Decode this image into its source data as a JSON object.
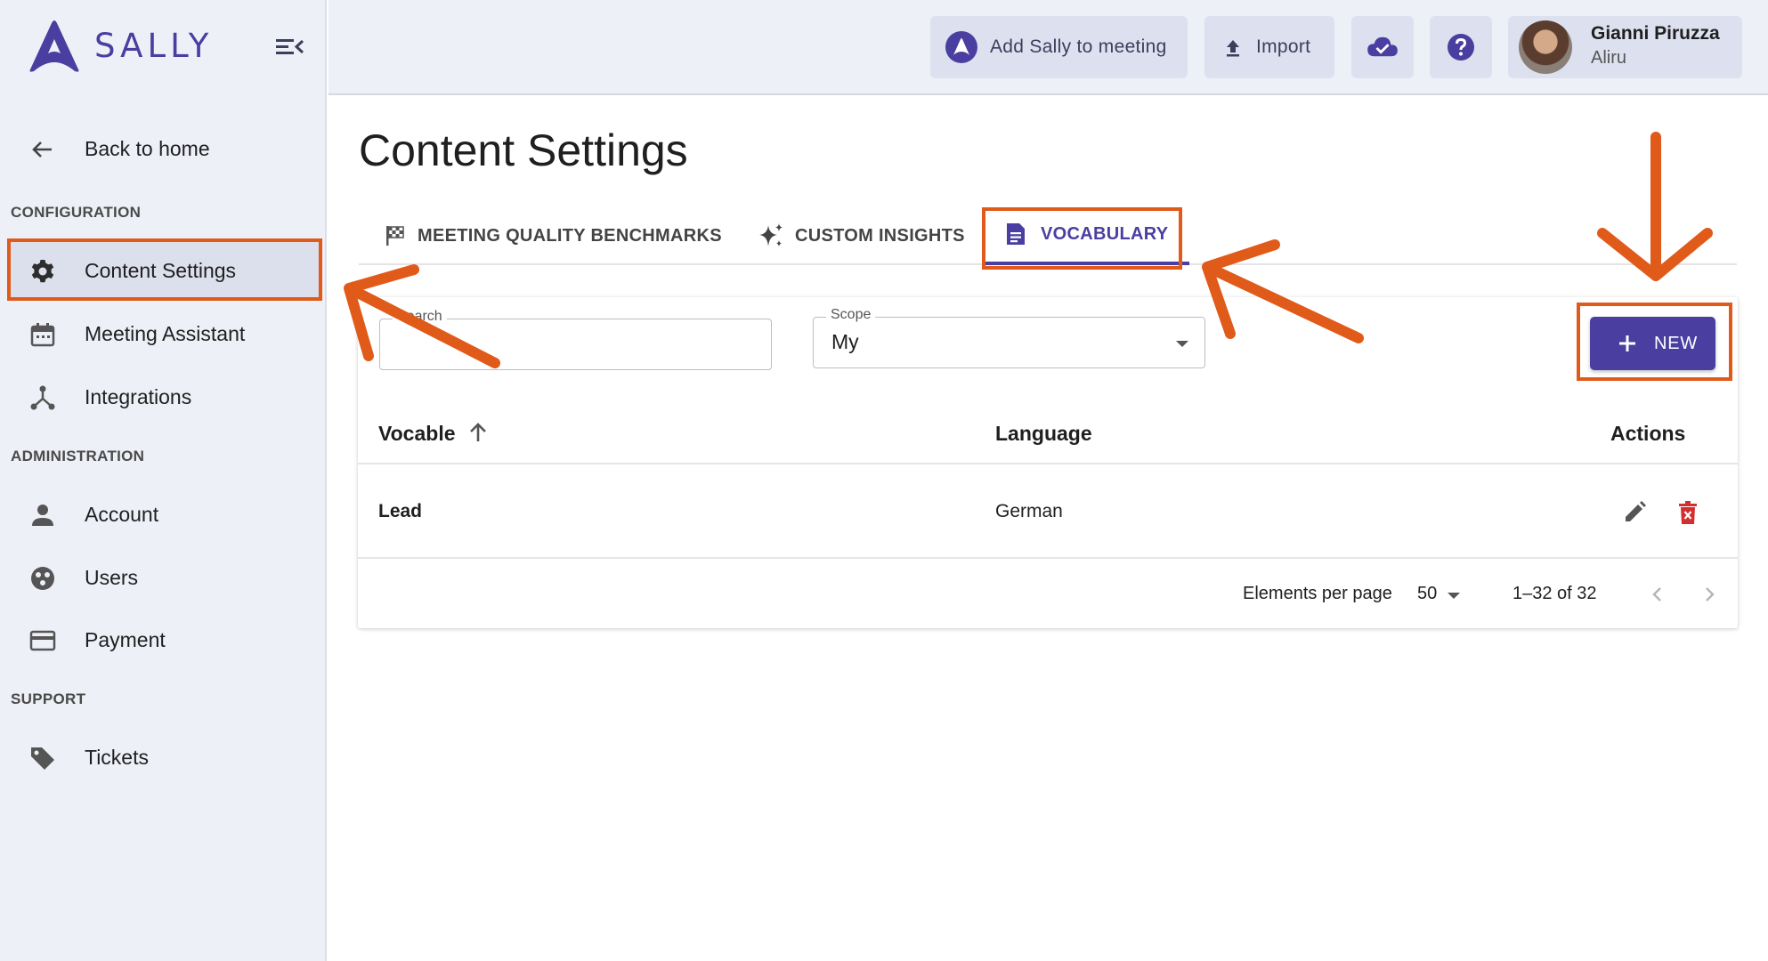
{
  "app": {
    "name": "SALLY"
  },
  "sidebar": {
    "back_label": "Back to home",
    "sections": {
      "configuration": "CONFIGURATION",
      "administration": "ADMINISTRATION",
      "support": "SUPPORT"
    },
    "items": [
      {
        "label": "Content Settings",
        "icon": "gear-icon",
        "active": true
      },
      {
        "label": "Meeting Assistant",
        "icon": "calendar-icon"
      },
      {
        "label": "Integrations",
        "icon": "integrations-icon"
      },
      {
        "label": "Account",
        "icon": "person-icon"
      },
      {
        "label": "Users",
        "icon": "users-icon"
      },
      {
        "label": "Payment",
        "icon": "credit-card-icon"
      },
      {
        "label": "Tickets",
        "icon": "tag-icon"
      }
    ]
  },
  "topbar": {
    "add_sally": "Add Sally to meeting",
    "import": "Import",
    "user": {
      "name": "Gianni Piruzza",
      "org": "Aliru"
    }
  },
  "main": {
    "title": "Content Settings",
    "tabs": [
      {
        "label": "MEETING QUALITY BENCHMARKS",
        "icon": "flag-icon"
      },
      {
        "label": "CUSTOM INSIGHTS",
        "icon": "sparkle-icon"
      },
      {
        "label": "VOCABULARY",
        "icon": "document-icon",
        "active": true
      }
    ],
    "search": {
      "label": "Search",
      "value": ""
    },
    "scope": {
      "label": "Scope",
      "value": "My"
    },
    "new_button": "NEW",
    "table": {
      "headers": {
        "vocable": "Vocable",
        "language": "Language",
        "actions": "Actions"
      },
      "rows": [
        {
          "vocable": "Lead",
          "language": "German"
        }
      ]
    },
    "pagination": {
      "per_page_label": "Elements per page",
      "per_page_value": "50",
      "range": "1–32 of 32"
    }
  },
  "colors": {
    "accent": "#4a3fa0",
    "annotation": "#e05a1a",
    "delete": "#d32f2f"
  }
}
